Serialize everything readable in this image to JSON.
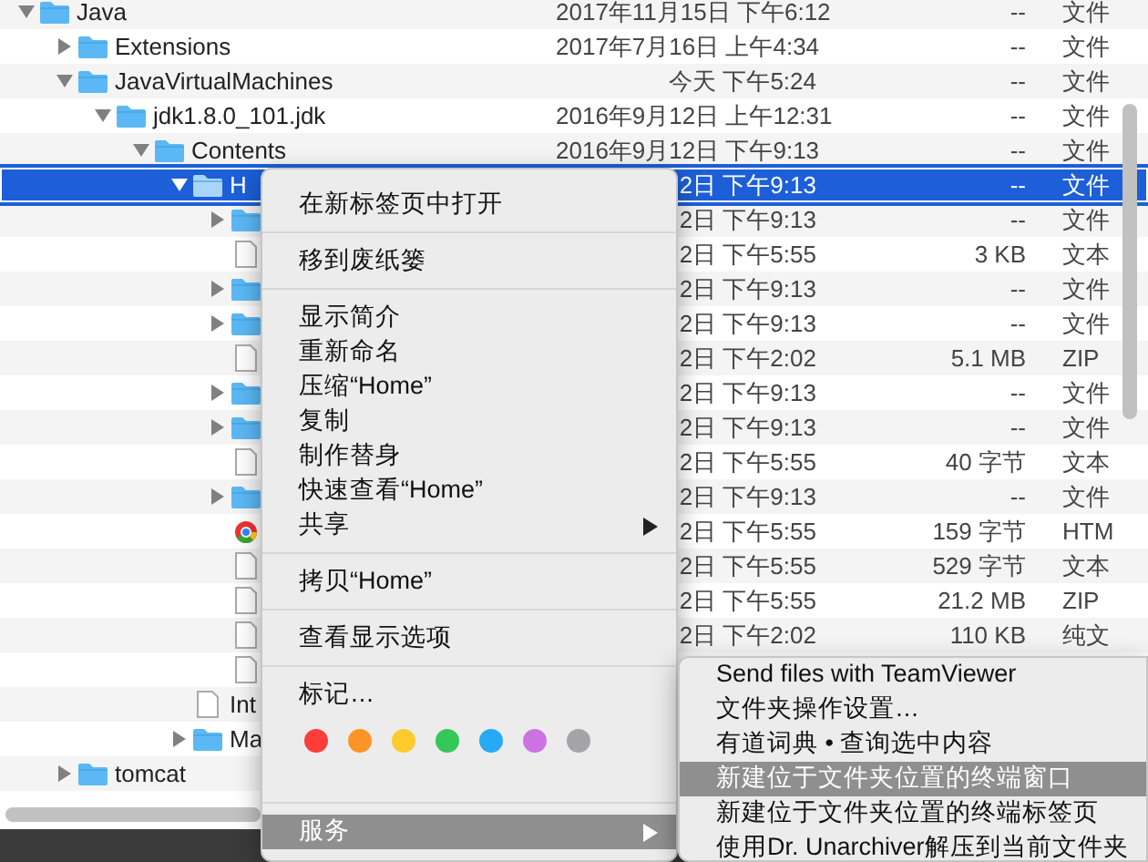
{
  "file_list": {
    "rows": [
      {
        "kind": "folder",
        "name": "Java",
        "expanded": true,
        "selected": false,
        "date": "2017年11月15日 下午6:12",
        "size": "--",
        "file_kind": "文件",
        "children": [
          {
            "kind": "folder",
            "name": "Extensions",
            "expanded": false,
            "selected": false,
            "date": "2017年7月16日 上午4:34",
            "size": "--",
            "file_kind": "文件"
          },
          {
            "kind": "folder",
            "name": "JavaVirtualMachines",
            "expanded": true,
            "selected": false,
            "date": "今天 下午5:24",
            "size": "--",
            "file_kind": "文件",
            "children": [
              {
                "kind": "folder",
                "name": "jdk1.8.0_101.jdk",
                "expanded": true,
                "selected": false,
                "date": "2016年9月12日 上午12:31",
                "size": "--",
                "file_kind": "文件",
                "children": [
                  {
                    "kind": "folder",
                    "name": "Contents",
                    "expanded": true,
                    "selected": false,
                    "date": "2016年9月12日 下午9:13",
                    "size": "--",
                    "file_kind": "文件",
                    "children": [
                      {
                        "kind": "folder",
                        "name": "H",
                        "expanded": true,
                        "selected": true,
                        "date": "2日 下午9:13",
                        "size": "--",
                        "file_kind": "文件",
                        "children": [
                          {
                            "kind": "folder",
                            "expanded": false,
                            "selected": false,
                            "date": "2日 下午9:13",
                            "size": "--",
                            "file_kind": "文件"
                          },
                          {
                            "kind": "document",
                            "selected": false,
                            "date": "2日 下午5:55",
                            "size": "3 KB",
                            "file_kind": "文本"
                          },
                          {
                            "kind": "folder",
                            "expanded": false,
                            "selected": false,
                            "date": "2日 下午9:13",
                            "size": "--",
                            "file_kind": "文件"
                          },
                          {
                            "kind": "folder",
                            "expanded": false,
                            "selected": false,
                            "date": "2日 下午9:13",
                            "size": "--",
                            "file_kind": "文件"
                          },
                          {
                            "kind": "document",
                            "selected": false,
                            "date": "2日 下午2:02",
                            "size": "5.1 MB",
                            "file_kind": "ZIP"
                          },
                          {
                            "kind": "folder",
                            "expanded": false,
                            "selected": false,
                            "date": "2日 下午9:13",
                            "size": "--",
                            "file_kind": "文件"
                          },
                          {
                            "kind": "folder",
                            "expanded": false,
                            "selected": false,
                            "date": "2日 下午9:13",
                            "size": "--",
                            "file_kind": "文件"
                          },
                          {
                            "kind": "document",
                            "selected": false,
                            "date": "2日 下午5:55",
                            "size": "40 字节",
                            "file_kind": "文本"
                          },
                          {
                            "kind": "folder",
                            "expanded": false,
                            "selected": false,
                            "date": "2日 下午9:13",
                            "size": "--",
                            "file_kind": "文件"
                          },
                          {
                            "kind": "web",
                            "selected": false,
                            "date": "2日 下午5:55",
                            "size": "159 字节",
                            "file_kind": "HTM"
                          },
                          {
                            "kind": "document",
                            "selected": false,
                            "date": "2日 下午5:55",
                            "size": "529 字节",
                            "file_kind": "文本"
                          },
                          {
                            "kind": "document",
                            "selected": false,
                            "date": "2日 下午5:55",
                            "size": "21.2 MB",
                            "file_kind": "ZIP"
                          },
                          {
                            "kind": "document",
                            "selected": false,
                            "date": "2日 下午2:02",
                            "size": "110 KB",
                            "file_kind": "纯文"
                          },
                          {
                            "kind": "document",
                            "selected": false
                          }
                        ]
                      },
                      {
                        "kind": "document",
                        "name": "Int",
                        "selected": false
                      },
                      {
                        "kind": "folder",
                        "name": "Ma",
                        "expanded": false,
                        "selected": false
                      }
                    ]
                  }
                ]
              }
            ]
          },
          {
            "kind": "folder",
            "name": "tomcat",
            "expanded": false,
            "selected": false
          }
        ]
      }
    ]
  },
  "context_menu": {
    "items": [
      {
        "kind": "item",
        "label": "在新标签页中打开",
        "highlighted": false
      },
      {
        "kind": "separator"
      },
      {
        "kind": "item",
        "label": "移到废纸篓",
        "highlighted": false
      },
      {
        "kind": "separator"
      },
      {
        "kind": "item",
        "label": "显示简介",
        "highlighted": false
      },
      {
        "kind": "item",
        "label": "重新命名",
        "highlighted": false
      },
      {
        "kind": "item",
        "label": "压缩“Home”",
        "highlighted": false
      },
      {
        "kind": "item",
        "label": "复制",
        "highlighted": false
      },
      {
        "kind": "item",
        "label": "制作替身",
        "highlighted": false
      },
      {
        "kind": "item",
        "label": "快速查看“Home”",
        "highlighted": false
      },
      {
        "kind": "item",
        "label": "共享",
        "highlighted": false,
        "submenu": true
      },
      {
        "kind": "separator"
      },
      {
        "kind": "item",
        "label": "拷贝“Home”",
        "highlighted": false
      },
      {
        "kind": "separator"
      },
      {
        "kind": "item",
        "label": "查看显示选项",
        "highlighted": false
      },
      {
        "kind": "separator"
      },
      {
        "kind": "item",
        "label": "标记…",
        "highlighted": false
      },
      {
        "kind": "tags",
        "tags": [
          {
            "color": "#fc3d39"
          },
          {
            "color": "#fd9426"
          },
          {
            "color": "#fecb2e"
          },
          {
            "color": "#35c759"
          },
          {
            "color": "#27aaf5"
          },
          {
            "color": "#cc73e1"
          },
          {
            "color": "#a4a4a8"
          }
        ]
      },
      {
        "kind": "separator"
      },
      {
        "kind": "item",
        "label": "服务",
        "highlighted": true,
        "submenu": true
      }
    ]
  },
  "services_submenu": {
    "items": [
      {
        "label": "Send files with TeamViewer",
        "highlighted": false
      },
      {
        "label": "文件夹操作设置…",
        "highlighted": false
      },
      {
        "label": "有道词典 • 查询选中内容",
        "highlighted": false
      },
      {
        "label": "新建位于文件夹位置的终端窗口",
        "highlighted": true
      },
      {
        "label": "新建位于文件夹位置的终端标签页",
        "highlighted": false
      },
      {
        "label": "使用Dr. Unarchiver解压到当前文件夹",
        "highlighted": false
      }
    ]
  }
}
